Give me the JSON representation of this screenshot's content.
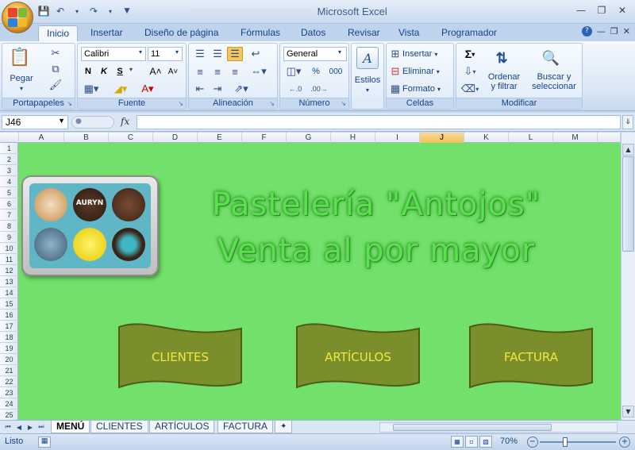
{
  "window": {
    "file_name": "",
    "app_name": "Microsoft Excel",
    "controls": [
      "minimize",
      "restore",
      "close"
    ]
  },
  "ribbon_tabs": [
    "Inicio",
    "Insertar",
    "Diseño de página",
    "Fórmulas",
    "Datos",
    "Revisar",
    "Vista",
    "Programador"
  ],
  "active_tab": "Inicio",
  "groups": {
    "portapapeles": {
      "label": "Portapapeles",
      "paste": "Pegar"
    },
    "fuente": {
      "label": "Fuente",
      "font": "Calibri",
      "size": "11",
      "bold": "N",
      "italic": "K",
      "underline": "S"
    },
    "alineacion": {
      "label": "Alineación"
    },
    "numero": {
      "label": "Número",
      "format": "General",
      "percent": "%",
      "thousands": "000"
    },
    "estilos": {
      "label": "Estilos"
    },
    "celdas": {
      "label": "Celdas",
      "insert": "Insertar",
      "delete": "Eliminar",
      "format": "Formato"
    },
    "modificar": {
      "label": "Modificar",
      "sort": "Ordenar",
      "sort2": "y filtrar",
      "find": "Buscar y",
      "find2": "seleccionar"
    }
  },
  "formula_bar": {
    "name_box": "J46",
    "fx": "fx",
    "formula": ""
  },
  "columns": [
    "A",
    "B",
    "C",
    "D",
    "E",
    "F",
    "G",
    "H",
    "I",
    "J",
    "K",
    "L",
    "M"
  ],
  "selected_column": "J",
  "rows": [
    "1",
    "2",
    "3",
    "4",
    "5",
    "6",
    "7",
    "8",
    "9",
    "10",
    "11",
    "12",
    "13",
    "14",
    "15",
    "16",
    "17",
    "18",
    "19",
    "20",
    "21",
    "22",
    "23",
    "24",
    "25"
  ],
  "sheet_content": {
    "title_line1": "Pastelería \"Antojos\"",
    "title_line2": "Venta al por mayor",
    "photo_label": "AURYN",
    "buttons": [
      "CLIENTES",
      "ARTÍCULOS",
      "FACTURA"
    ],
    "colors": {
      "background": "#72e06a",
      "banner_fill": "#7a8f2c",
      "banner_text": "#f2e640",
      "title": "#5be04f"
    }
  },
  "sheet_tabs": [
    "MENÚ",
    "CLIENTES",
    "ARTÍCULOS",
    "FACTURA"
  ],
  "active_sheet": "MENÚ",
  "status": {
    "ready": "Listo",
    "zoom": "70%"
  }
}
